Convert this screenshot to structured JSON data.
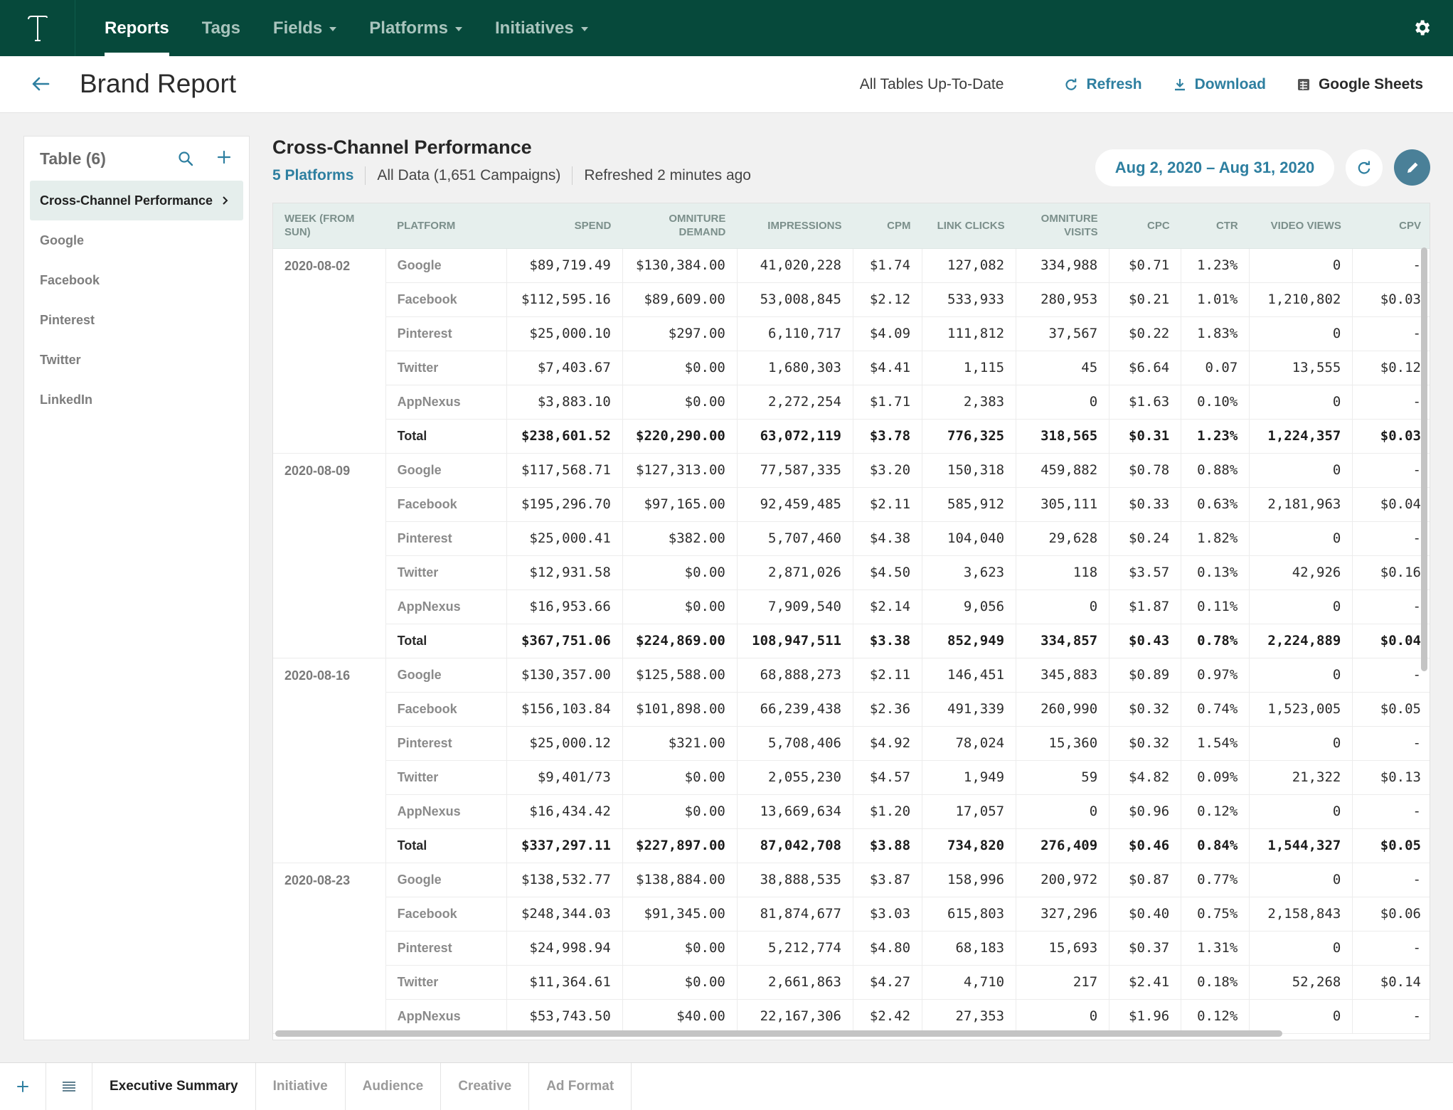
{
  "nav": {
    "items": [
      {
        "label": "Reports",
        "active": true,
        "dropdown": false
      },
      {
        "label": "Tags",
        "active": false,
        "dropdown": false
      },
      {
        "label": "Fields",
        "active": false,
        "dropdown": true
      },
      {
        "label": "Platforms",
        "active": false,
        "dropdown": true
      },
      {
        "label": "Initiatives",
        "active": false,
        "dropdown": true
      }
    ]
  },
  "header": {
    "title": "Brand Report",
    "status": "All Tables Up-To-Date",
    "refresh_label": "Refresh",
    "download_label": "Download",
    "sheets_label": "Google Sheets"
  },
  "sidebar": {
    "title": "Table (6)",
    "items": [
      {
        "label": "Cross-Channel Performance",
        "active": true
      },
      {
        "label": "Google",
        "active": false
      },
      {
        "label": "Facebook",
        "active": false
      },
      {
        "label": "Pinterest",
        "active": false
      },
      {
        "label": "Twitter",
        "active": false
      },
      {
        "label": "LinkedIn",
        "active": false
      }
    ]
  },
  "main": {
    "title": "Cross-Channel Performance",
    "platforms_link": "5 Platforms",
    "data_scope": "All Data (1,651 Campaigns)",
    "refreshed": "Refreshed 2 minutes ago",
    "date_range": "Aug 2, 2020 – Aug 31, 2020"
  },
  "table": {
    "columns": [
      "WEEK (FROM SUN)",
      "PLATFORM",
      "SPEND",
      "OMNITURE DEMAND",
      "IMPRESSIONS",
      "CPM",
      "LINK CLICKS",
      "OMNITURE VISITS",
      "CPC",
      "CTR",
      "VIDEO VIEWS",
      "CPV"
    ],
    "groups": [
      {
        "week": "2020-08-02",
        "rows": [
          [
            "Google",
            "$89,719.49",
            "$130,384.00",
            "41,020,228",
            "$1.74",
            "127,082",
            "334,988",
            "$0.71",
            "1.23%",
            "0",
            "-"
          ],
          [
            "Facebook",
            "$112,595.16",
            "$89,609.00",
            "53,008,845",
            "$2.12",
            "533,933",
            "280,953",
            "$0.21",
            "1.01%",
            "1,210,802",
            "$0.03"
          ],
          [
            "Pinterest",
            "$25,000.10",
            "$297.00",
            "6,110,717",
            "$4.09",
            "111,812",
            "37,567",
            "$0.22",
            "1.83%",
            "0",
            "-"
          ],
          [
            "Twitter",
            "$7,403.67",
            "$0.00",
            "1,680,303",
            "$4.41",
            "1,115",
            "45",
            "$6.64",
            "0.07",
            "13,555",
            "$0.12"
          ],
          [
            "AppNexus",
            "$3,883.10",
            "$0.00",
            "2,272,254",
            "$1.71",
            "2,383",
            "0",
            "$1.63",
            "0.10%",
            "0",
            "-"
          ],
          [
            "Total",
            "$238,601.52",
            "$220,290.00",
            "63,072,119",
            "$3.78",
            "776,325",
            "318,565",
            "$0.31",
            "1.23%",
            "1,224,357",
            "$0.03"
          ]
        ]
      },
      {
        "week": "2020-08-09",
        "rows": [
          [
            "Google",
            "$117,568.71",
            "$127,313.00",
            "77,587,335",
            "$3.20",
            "150,318",
            "459,882",
            "$0.78",
            "0.88%",
            "0",
            "-"
          ],
          [
            "Facebook",
            "$195,296.70",
            "$97,165.00",
            "92,459,485",
            "$2.11",
            "585,912",
            "305,111",
            "$0.33",
            "0.63%",
            "2,181,963",
            "$0.04"
          ],
          [
            "Pinterest",
            "$25,000.41",
            "$382.00",
            "5,707,460",
            "$4.38",
            "104,040",
            "29,628",
            "$0.24",
            "1.82%",
            "0",
            "-"
          ],
          [
            "Twitter",
            "$12,931.58",
            "$0.00",
            "2,871,026",
            "$4.50",
            "3,623",
            "118",
            "$3.57",
            "0.13%",
            "42,926",
            "$0.16"
          ],
          [
            "AppNexus",
            "$16,953.66",
            "$0.00",
            "7,909,540",
            "$2.14",
            "9,056",
            "0",
            "$1.87",
            "0.11%",
            "0",
            "-"
          ],
          [
            "Total",
            "$367,751.06",
            "$224,869.00",
            "108,947,511",
            "$3.38",
            "852,949",
            "334,857",
            "$0.43",
            "0.78%",
            "2,224,889",
            "$0.04"
          ]
        ]
      },
      {
        "week": "2020-08-16",
        "rows": [
          [
            "Google",
            "$130,357.00",
            "$125,588.00",
            "68,888,273",
            "$2.11",
            "146,451",
            "345,883",
            "$0.89",
            "0.97%",
            "0",
            "-"
          ],
          [
            "Facebook",
            "$156,103.84",
            "$101,898.00",
            "66,239,438",
            "$2.36",
            "491,339",
            "260,990",
            "$0.32",
            "0.74%",
            "1,523,005",
            "$0.05"
          ],
          [
            "Pinterest",
            "$25,000.12",
            "$321.00",
            "5,708,406",
            "$4.92",
            "78,024",
            "15,360",
            "$0.32",
            "1.54%",
            "0",
            "-"
          ],
          [
            "Twitter",
            "$9,401/73",
            "$0.00",
            "2,055,230",
            "$4.57",
            "1,949",
            "59",
            "$4.82",
            "0.09%",
            "21,322",
            "$0.13"
          ],
          [
            "AppNexus",
            "$16,434.42",
            "$0.00",
            "13,669,634",
            "$1.20",
            "17,057",
            "0",
            "$0.96",
            "0.12%",
            "0",
            "-"
          ],
          [
            "Total",
            "$337,297.11",
            "$227,897.00",
            "87,042,708",
            "$3.88",
            "734,820",
            "276,409",
            "$0.46",
            "0.84%",
            "1,544,327",
            "$0.05"
          ]
        ]
      },
      {
        "week": "2020-08-23",
        "rows": [
          [
            "Google",
            "$138,532.77",
            "$138,884.00",
            "38,888,535",
            "$3.87",
            "158,996",
            "200,972",
            "$0.87",
            "0.77%",
            "0",
            "-"
          ],
          [
            "Facebook",
            "$248,344.03",
            "$91,345.00",
            "81,874,677",
            "$3.03",
            "615,803",
            "327,296",
            "$0.40",
            "0.75%",
            "2,158,843",
            "$0.06"
          ],
          [
            "Pinterest",
            "$24,998.94",
            "$0.00",
            "5,212,774",
            "$4.80",
            "68,183",
            "15,693",
            "$0.37",
            "1.31%",
            "0",
            "-"
          ],
          [
            "Twitter",
            "$11,364.61",
            "$0.00",
            "2,661,863",
            "$4.27",
            "4,710",
            "217",
            "$2.41",
            "0.18%",
            "52,268",
            "$0.14"
          ],
          [
            "AppNexus",
            "$53,743.50",
            "$40.00",
            "22,167,306",
            "$2.42",
            "27,353",
            "0",
            "$1.96",
            "0.12%",
            "0",
            "-"
          ]
        ]
      }
    ]
  },
  "bottom_tabs": [
    {
      "label": "Executive Summary",
      "active": true
    },
    {
      "label": "Initiative",
      "active": false
    },
    {
      "label": "Audience",
      "active": false
    },
    {
      "label": "Creative",
      "active": false
    },
    {
      "label": "Ad Format",
      "active": false
    }
  ],
  "colors": {
    "nav_bg": "#06493b",
    "accent": "#2e7fa0",
    "edit_button": "#4a8098"
  },
  "icons": {
    "logo": "t-logo-icon",
    "settings": "gear-icon",
    "back": "back-arrow-icon",
    "refresh": "refresh-icon",
    "download": "download-icon",
    "sheets": "sheets-icon",
    "search": "search-icon",
    "add": "plus-icon",
    "edit": "pencil-icon",
    "list": "list-icon"
  }
}
